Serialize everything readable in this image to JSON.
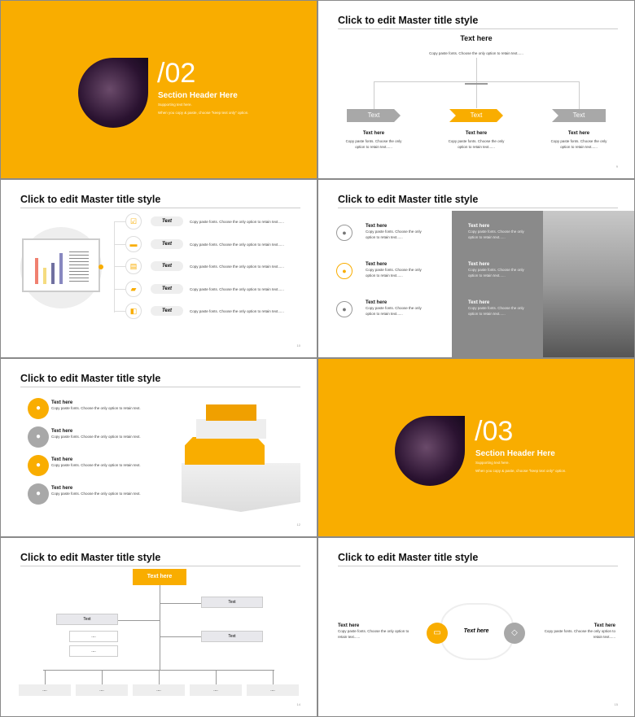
{
  "accent": "#f9ad00",
  "master_title": "Click to edit Master title style",
  "s1": {
    "num": "/02",
    "header": "Section Header Here",
    "sub": "Supporting text here.",
    "note": "When you copy & paste, choose \"keep text only\" option."
  },
  "s2": {
    "top_title": "Text here",
    "top_text": "Copy paste fonts. Choose the only option to retain text......",
    "arrows": [
      "Text",
      "Text",
      "Text"
    ],
    "items": [
      {
        "title": "Text here",
        "text": "Copy paste fonts. Choose the only option to retain text......"
      },
      {
        "title": "Text here",
        "text": "Copy paste fonts. Choose the only option to retain text......"
      },
      {
        "title": "Text here",
        "text": "Copy paste fonts. Choose the only option to retain text......"
      }
    ],
    "page": "9"
  },
  "s3": {
    "pills": [
      "Text",
      "Text",
      "Text",
      "Text",
      "Text"
    ],
    "icons": [
      "checkbox-icon",
      "monitor-icon",
      "clipboard-icon",
      "folder-icon",
      "book-icon"
    ],
    "text": "Copy paste fonts. Choose the only option to retain text......",
    "page": "10"
  },
  "s4": {
    "left": [
      {
        "title": "Text here",
        "text": "Copy paste fonts. Choose the only option to retain text......"
      },
      {
        "title": "Text here",
        "text": "Copy paste fonts. Choose the only option to retain text......"
      },
      {
        "title": "Text here",
        "text": "Copy paste fonts. Choose the only option to retain text......"
      }
    ],
    "right": [
      {
        "title": "Text here",
        "text": "Copy paste fonts. Choose the only option to retain text......"
      },
      {
        "title": "Text here",
        "text": "Copy paste fonts. Choose the only option to retain text......"
      },
      {
        "title": "Text here",
        "text": "Copy paste fonts. Choose the only option to retain text......"
      }
    ],
    "page": "11"
  },
  "s5": {
    "items": [
      {
        "title": "Text here",
        "text": "Copy paste fonts. Choose the only option to retain text."
      },
      {
        "title": "Text here",
        "text": "Copy paste fonts. Choose the only option to retain text."
      },
      {
        "title": "Text here",
        "text": "Copy paste fonts. Choose the only option to retain text."
      },
      {
        "title": "Text here",
        "text": "Copy paste fonts. Choose the only option to retain text."
      }
    ],
    "page": "12"
  },
  "s6": {
    "num": "/03",
    "header": "Section Header Here",
    "sub": "Supporting text here.",
    "note": "When you copy & paste, choose \"keep text only\" option."
  },
  "s7": {
    "root": "Text here",
    "left": "Text",
    "right": [
      "Text",
      "Text"
    ],
    "subs": [
      "....",
      "...."
    ],
    "bottom": [
      "....",
      "....",
      "....",
      "....",
      "...."
    ],
    "page": "14"
  },
  "s8": {
    "center": "Text here",
    "left": {
      "title": "Text here",
      "text": "Copy paste fonts. Choose the only option to retain text......"
    },
    "right": {
      "title": "Text here",
      "text": "Copy paste fonts. Choose the only option to retain text......"
    },
    "page": "15"
  }
}
